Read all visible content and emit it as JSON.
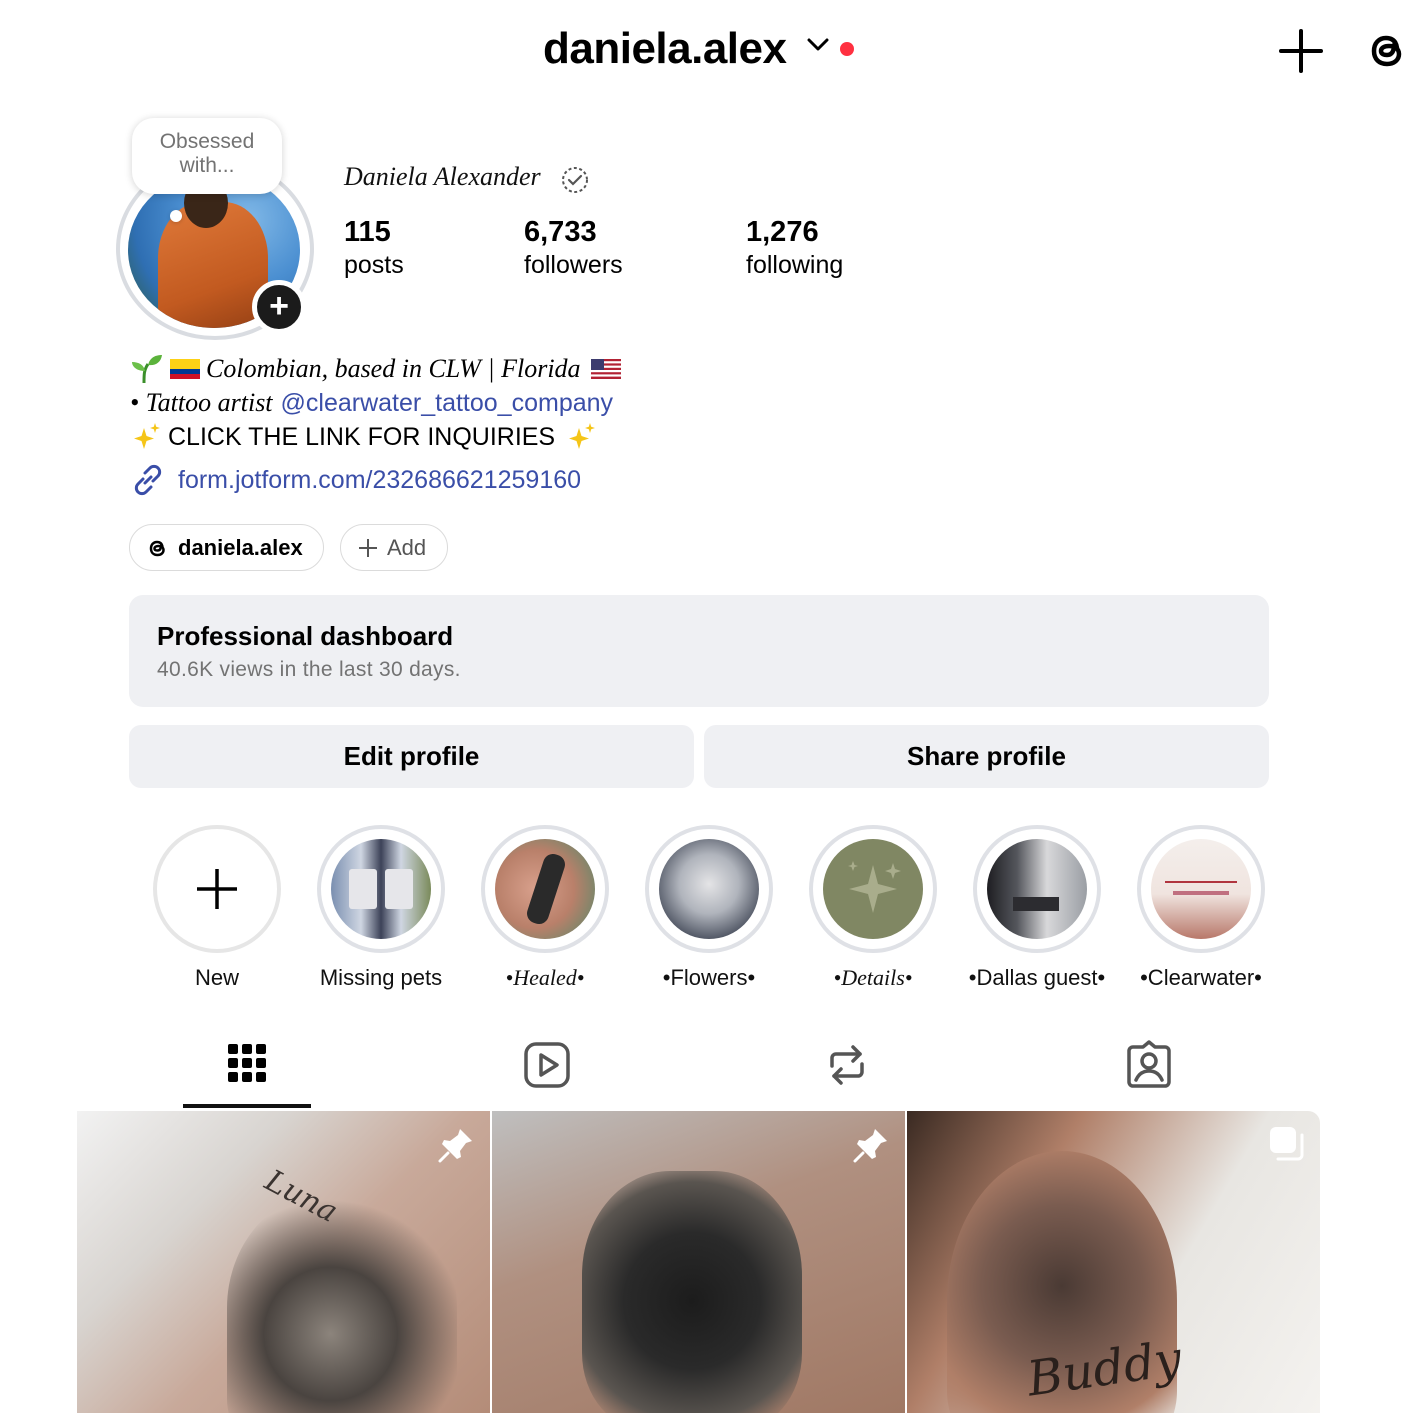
{
  "header": {
    "username": "daniela.alex",
    "notification_dot_color": "#ff3040"
  },
  "profile": {
    "note": "Obsessed with...",
    "full_name": "Daniela Alexander",
    "stats": {
      "posts": {
        "value": "115",
        "label": "posts"
      },
      "followers": {
        "value": "6,733",
        "label": "followers"
      },
      "following": {
        "value": "1,276",
        "label": "following"
      }
    },
    "bio": {
      "line1": "Colombian, based in CLW | Florida",
      "line2_prefix": "• Tattoo artist",
      "line2_mention": "@clearwater_tattoo_company",
      "line3": "CLICK THE LINK FOR INQUIRIES",
      "link": "form.jotform.com/232686621259160"
    },
    "accent_link_color": "#3a4ea8"
  },
  "pills": {
    "threads_handle": "daniela.alex",
    "add_label": "Add"
  },
  "dashboard": {
    "title": "Professional dashboard",
    "subtitle": "40.6K views in the last 30 days."
  },
  "buttons": {
    "edit": "Edit profile",
    "share": "Share profile"
  },
  "highlights": [
    {
      "label": "New"
    },
    {
      "label": "Missing pets"
    },
    {
      "label": "•Healed•"
    },
    {
      "label": "•Flowers•"
    },
    {
      "label": "•Details•"
    },
    {
      "label": "•Dallas guest•"
    },
    {
      "label": "•Clearwater•"
    }
  ],
  "tabs": [
    {
      "name": "grid-icon",
      "active": true
    },
    {
      "name": "reels-icon",
      "active": false
    },
    {
      "name": "reposts-icon",
      "active": false
    },
    {
      "name": "tagged-icon",
      "active": false
    }
  ],
  "grid": [
    {
      "name": "tattoo-post-luna",
      "pinned": true,
      "tattoo_script": "Luna"
    },
    {
      "name": "tattoo-post-dog",
      "pinned": true
    },
    {
      "name": "tattoo-post-buddy",
      "carousel": true,
      "tattoo_script": "Buddy"
    }
  ]
}
